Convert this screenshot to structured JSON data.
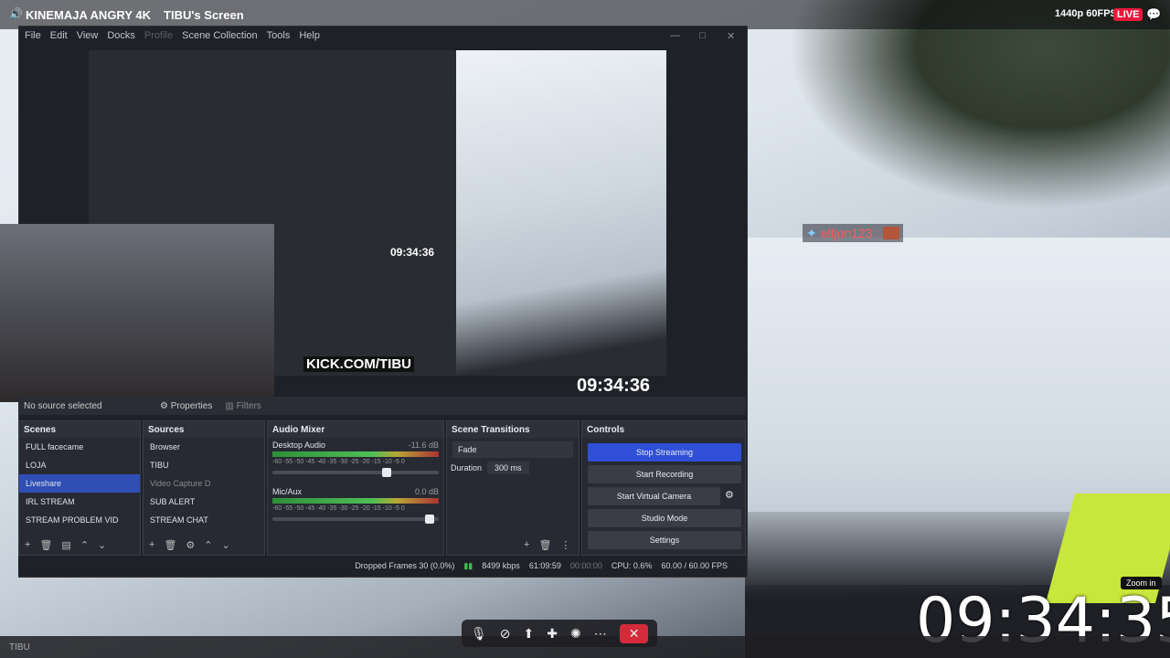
{
  "stream": {
    "channel_title": "KINEMAJA ANGRY 4K",
    "screen_title": "TIBU's Screen",
    "quality": "1440p 60FPS",
    "live_label": "LIVE"
  },
  "obs": {
    "menu": [
      "File",
      "Edit",
      "View",
      "Docks",
      "Profile",
      "Scene Collection",
      "Tools",
      "Help"
    ],
    "preview_clock_small": "09:34:36",
    "preview_clock_large": "09:34:36",
    "kick_label": "KICK.COM/TIBU",
    "no_source": "No source selected",
    "properties": "Properties",
    "filters": "Filters",
    "scenes": {
      "title": "Scenes",
      "items": [
        "FULL facecame",
        "LOJA",
        "Liveshare",
        "IRL STREAM",
        "STREAM PROBLEM VID"
      ],
      "selected": "Liveshare"
    },
    "sources": {
      "title": "Sources",
      "items": [
        "Browser",
        "TIBU",
        "Video Capture D",
        "SUB ALERT",
        "STREAM CHAT"
      ]
    },
    "mixer": {
      "title": "Audio Mixer",
      "channels": [
        {
          "name": "Desktop Audio",
          "db": "-11.6 dB",
          "level": 0.82
        },
        {
          "name": "Mic/Aux",
          "db": "0.0 dB",
          "level": 1.0
        }
      ],
      "ticks": "-60 -55 -50 -45 -40 -35 -30 -25 -20 -15 -10 -5 0"
    },
    "transitions": {
      "title": "Scene Transitions",
      "type": "Fade",
      "duration_label": "Duration",
      "duration_value": "300 ms"
    },
    "controls": {
      "title": "Controls",
      "stop_streaming": "Stop Streaming",
      "start_recording": "Start Recording",
      "start_virtual_camera": "Start Virtual Camera",
      "studio_mode": "Studio Mode",
      "settings": "Settings"
    },
    "status": {
      "dropped_frames": "Dropped Frames 30 (0.0%)",
      "kbps": "8499 kbps",
      "stream_time": "61:09:59",
      "rec_time": "00:00:00",
      "cpu": "CPU: 0.6%",
      "fps": "60.00 / 60.00 FPS"
    }
  },
  "chat_overlay": {
    "user": "eltjon123 :"
  },
  "viewer": {
    "zoom_tooltip": "Zoom in",
    "big_clock": "09:34:35",
    "taskbar_label": "TIBU"
  }
}
